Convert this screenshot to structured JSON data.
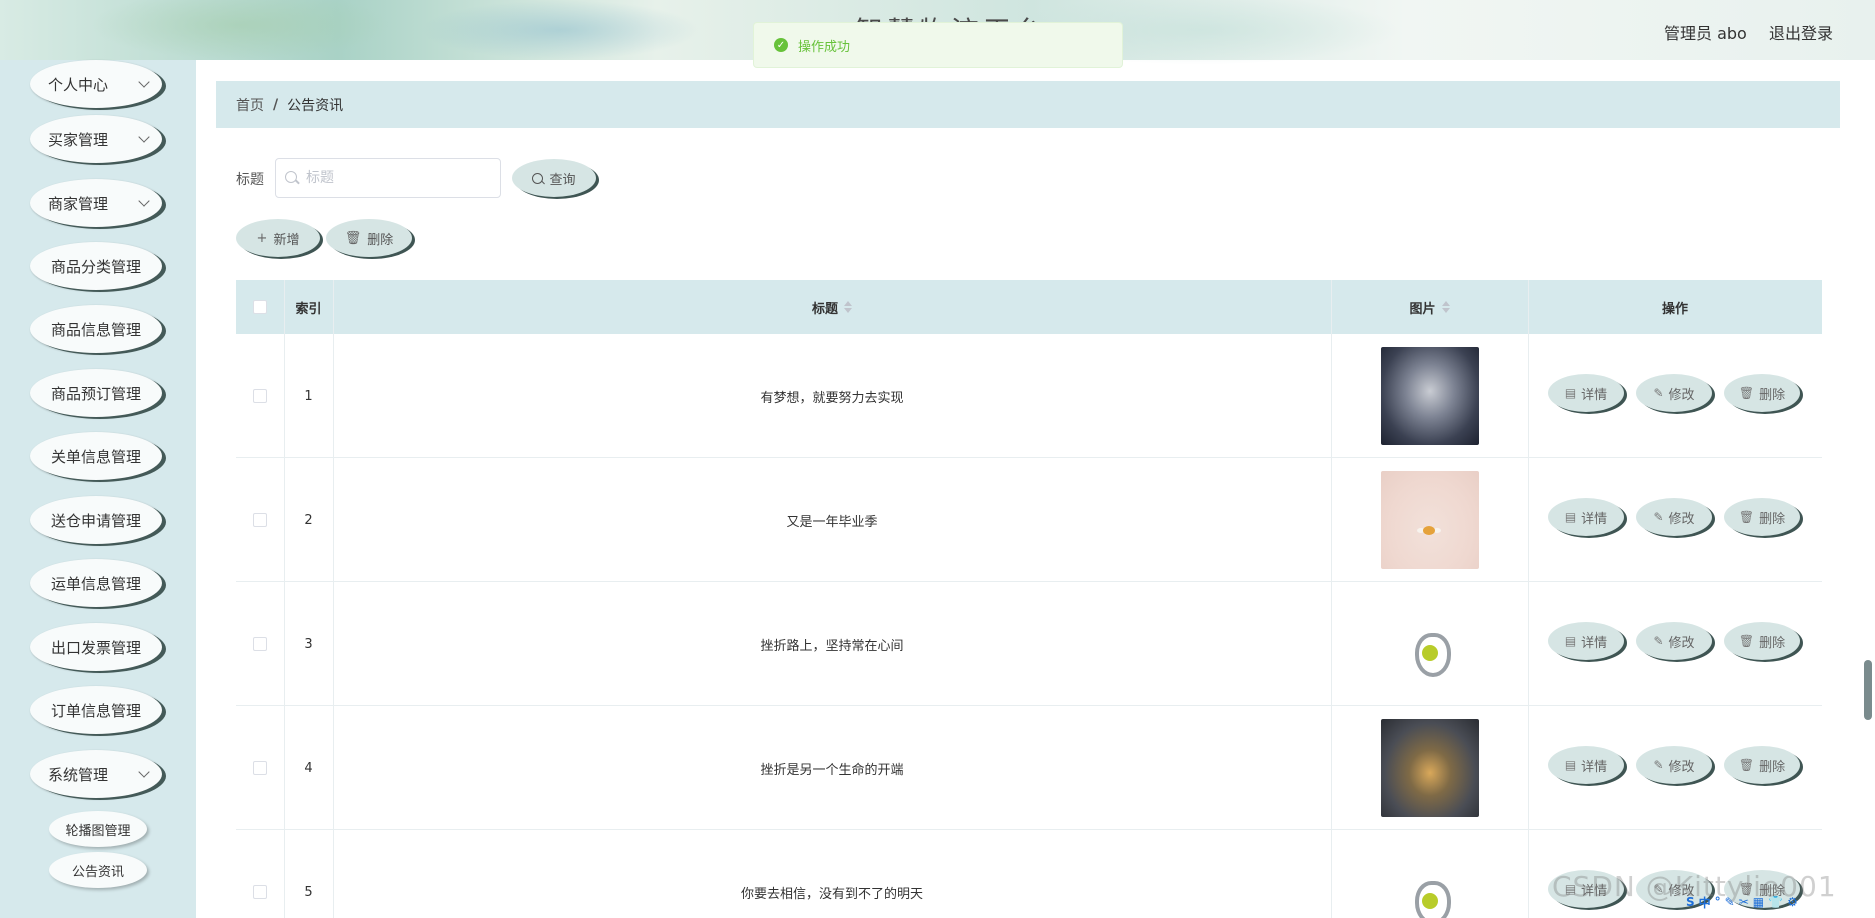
{
  "header": {
    "site_title": "智慧物流平台",
    "admin_label": "管理员 abo",
    "logout_label": "退出登录"
  },
  "toast": {
    "message": "操作成功",
    "icon": "success-check-icon",
    "color": "#67c23a"
  },
  "sidebar": {
    "items": [
      {
        "label": "个人中心",
        "arrow": true
      },
      {
        "label": "买家管理",
        "arrow": true
      },
      {
        "label": "商家管理",
        "arrow": true
      },
      {
        "label": "商品分类管理",
        "arrow": false
      },
      {
        "label": "商品信息管理",
        "arrow": false
      },
      {
        "label": "商品预订管理",
        "arrow": false
      },
      {
        "label": "关单信息管理",
        "arrow": false
      },
      {
        "label": "送仓申请管理",
        "arrow": false
      },
      {
        "label": "运单信息管理",
        "arrow": false
      },
      {
        "label": "出口发票管理",
        "arrow": false
      },
      {
        "label": "订单信息管理",
        "arrow": false
      },
      {
        "label": "系统管理",
        "arrow": true
      }
    ],
    "sub_items": [
      "轮播图管理",
      "公告资讯"
    ]
  },
  "breadcrumb": {
    "home": "首页",
    "separator": "/",
    "current": "公告资讯"
  },
  "search": {
    "label": "标题",
    "placeholder": "标题",
    "value": "",
    "query_button": "查询"
  },
  "toolbar": {
    "add_label": "新增",
    "delete_label": "删除"
  },
  "table": {
    "headers": {
      "index": "索引",
      "title": "标题",
      "image": "图片",
      "actions": "操作"
    },
    "rows": [
      {
        "index": "1",
        "title": "有梦想，就要努力去实现",
        "image": "butterfly-brooch-image"
      },
      {
        "index": "2",
        "title": "又是一年毕业季",
        "image": "flower-necklace-image"
      },
      {
        "index": "3",
        "title": "挫折路上，坚持常在心间",
        "image": "peridot-pendant-image"
      },
      {
        "index": "4",
        "title": "挫折是另一个生命的开端",
        "image": "jade-brooch-image"
      },
      {
        "index": "5",
        "title": "你要去相信，没有到不了的明天",
        "image": "peridot-pendant-image"
      }
    ],
    "action_labels": {
      "detail": "详情",
      "edit": "修改",
      "delete": "删除"
    }
  },
  "watermark": "CSDN @Kittylie001",
  "colors": {
    "header_bg": "#a9d2c6",
    "sidebar_bg": "#d6e9ec",
    "accent": "#67c23a",
    "button_shadow": "#3f5553"
  }
}
